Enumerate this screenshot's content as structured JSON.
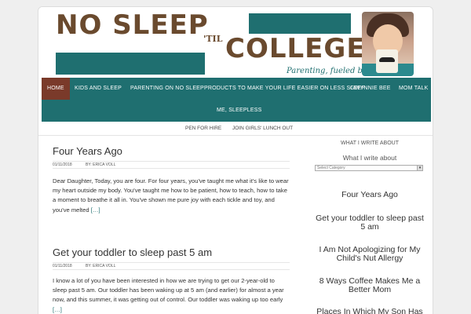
{
  "header": {
    "logo_line1": "NO SLEEP",
    "logo_til": "'TIL",
    "logo_line2": "COLLEGE",
    "tagline": "Parenting, fueled by caffeine",
    "photo_icon": "profile-photo"
  },
  "nav": {
    "items": [
      {
        "label": "HOME"
      },
      {
        "label": "KIDS AND SLEEP"
      },
      {
        "label": "PARENTING ON NO SLEEP"
      },
      {
        "label": "PRODUCTS TO MAKE YOUR LIFE EASIER ON LESS SLEEP"
      },
      {
        "label": "GWYNNIE BEE"
      },
      {
        "label": "MOM TALK"
      },
      {
        "label": "ME, SLEEPLESS"
      }
    ]
  },
  "subnav": {
    "items": [
      {
        "label": "PEN FOR HIRE"
      },
      {
        "label": "JOIN GIRLS' LUNCH OUT"
      }
    ]
  },
  "posts": [
    {
      "title": "Four Years Ago",
      "date": "01/11/2018",
      "author": "BY: ERICA VOLL",
      "excerpt": "Dear Daughter, Today, you are four. For four years, you've taught me what it's like to wear my heart outside my body. You've taught me how to be patient, how to teach, how to take a moment to breathe it all in. You've shown me pure joy with each tickle and toy, and you've melted",
      "more": "[…]"
    },
    {
      "title": "Get your toddler to sleep past 5 am",
      "date": "01/11/2018",
      "author": "BY: ERICA VOLL",
      "excerpt": "I know a lot of you have been interested in how we are trying to get our 2-year-old to sleep past 5 am. Our toddler has been waking up at 5 am (and earlier) for almost a year now, and this summer, it was getting out of control. Our toddler was waking up too early",
      "more": "[…]"
    }
  ],
  "sidebar": {
    "widget_title": "WHAT I WRITE ABOUT",
    "widget_sub": "What I write about",
    "select_placeholder": "Select Category",
    "links": [
      {
        "label": "Four Years Ago"
      },
      {
        "label": "Get your toddler to sleep past 5 am"
      },
      {
        "label": "I Am Not Apologizing for My Child's Nut Allergy"
      },
      {
        "label": "8 Ways Coffee Makes Me a Better Mom"
      },
      {
        "label": "Places In Which My Son Has Pulled Down His"
      }
    ]
  },
  "colors": {
    "teal": "#1f6f70",
    "brown": "#6a4a2e",
    "active_nav": "#7a3a2a"
  }
}
